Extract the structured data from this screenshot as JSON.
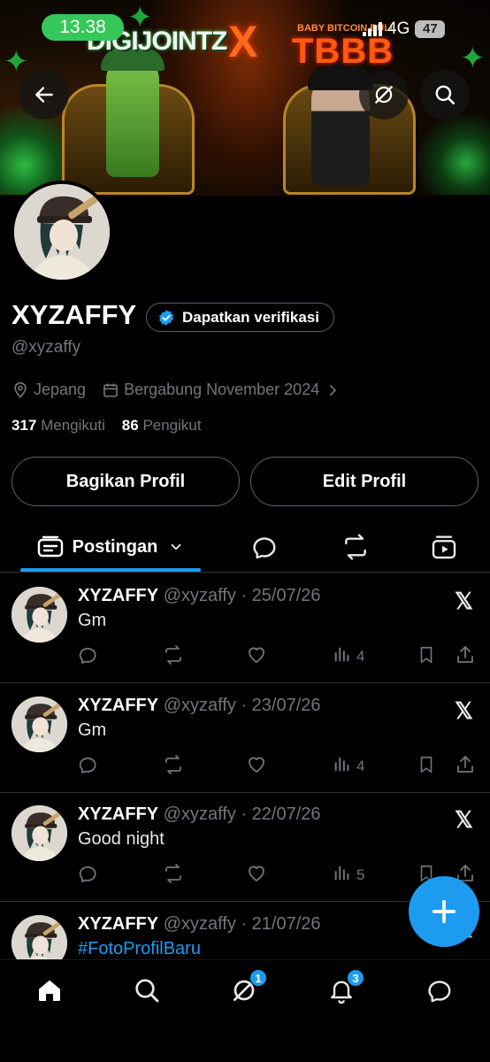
{
  "status_bar": {
    "time": "13.38",
    "network": "4G",
    "battery": "47"
  },
  "banner": {
    "left_brand": "DIGIJOINTZ",
    "cross": "X",
    "right_brand_small": "BABY BITCOIN BULL",
    "right_brand": "TBBB"
  },
  "profile": {
    "name": "XYZAFFY",
    "verify_label": "Dapatkan verifikasi",
    "handle": "@xyzaffy",
    "location": "Jepang",
    "joined": "Bergabung November 2024",
    "following_count": "317",
    "following_label": "Mengikuti",
    "followers_count": "86",
    "followers_label": "Pengikut"
  },
  "buttons": {
    "share": "Bagikan Profil",
    "edit": "Edit Profil"
  },
  "tabs": {
    "posts": "Postingan"
  },
  "tweets": [
    {
      "name": "XYZAFFY",
      "meta": "@xyzaffy · 25/07/26",
      "text": "Gm",
      "views": "4",
      "is_link": false
    },
    {
      "name": "XYZAFFY",
      "meta": "@xyzaffy · 23/07/26",
      "text": "Gm",
      "views": "4",
      "is_link": false
    },
    {
      "name": "XYZAFFY",
      "meta": "@xyzaffy · 22/07/26",
      "text": "Good night",
      "views": "5",
      "is_link": false
    },
    {
      "name": "XYZAFFY",
      "meta": "@xyzaffy · 21/07/26",
      "text": "#FotoProfilBaru",
      "views": "",
      "is_link": true
    }
  ],
  "nav": {
    "grok_badge": "1",
    "notifications_badge": "3"
  },
  "colors": {
    "accent": "#1d9bf0",
    "status_time_bg": "#35c759"
  }
}
